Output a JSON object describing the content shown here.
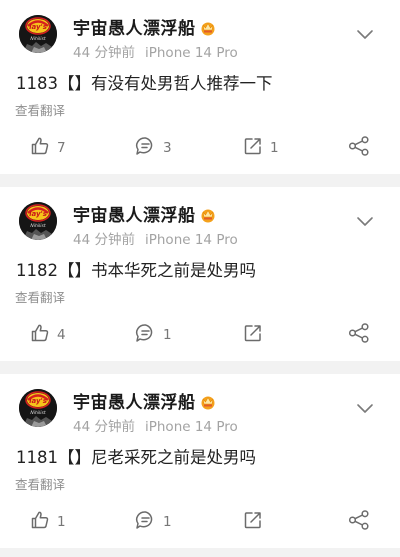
{
  "posts": [
    {
      "username": "宇宙愚人漂浮船",
      "avatar_text": "lay's",
      "avatar_sub": "Nihilist",
      "time": "44 分钟前",
      "device": "iPhone 14 Pro",
      "text": "1183【】有没有处男哲人推荐一下",
      "translate": "查看翻译",
      "likes": "7",
      "comments": "3",
      "reposts": "1"
    },
    {
      "username": "宇宙愚人漂浮船",
      "avatar_text": "lay's",
      "avatar_sub": "Nihilist",
      "time": "44 分钟前",
      "device": "iPhone 14 Pro",
      "text": "1182【】书本华死之前是处男吗",
      "translate": "查看翻译",
      "likes": "4",
      "comments": "1",
      "reposts": ""
    },
    {
      "username": "宇宙愚人漂浮船",
      "avatar_text": "lay's",
      "avatar_sub": "Nihilist",
      "time": "44 分钟前",
      "device": "iPhone 14 Pro",
      "text": "1181【】尼老采死之前是处男吗",
      "translate": "查看翻译",
      "likes": "1",
      "comments": "1",
      "reposts": ""
    }
  ],
  "icons": {
    "more": "chevron-down-icon",
    "like": "thumbs-up-icon",
    "comment": "comment-bubble-icon",
    "repost": "repost-icon",
    "share": "share-icon",
    "badge": "vip-crown-badge-icon"
  },
  "colors": {
    "icon_gray": "#6b6b6b",
    "meta_gray": "#a3a3a3",
    "badge_orange": "#f4a11c"
  }
}
